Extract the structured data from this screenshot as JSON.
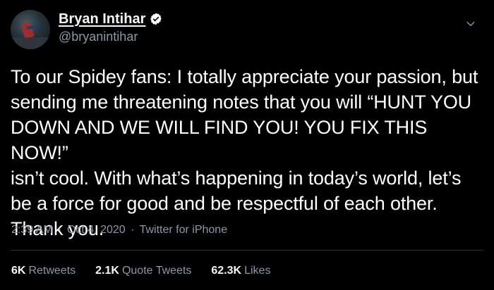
{
  "tweet": {
    "author": {
      "display_name": "Bryan Intihar",
      "handle": "@bryanintihar",
      "verified": true,
      "avatar_icon": "avatar-image"
    },
    "menu_icon": "chevron-down-icon",
    "text": "To our Spidey fans: I totally appreciate your passion, but\nsending me threatening notes that you will “HUNT YOU\nDOWN AND WE WILL FIND YOU! YOU FIX THIS NOW!”\nisn’t cool. With what’s happening in today’s world, let’s\nbe a force for good and be respectful of each other.\nThank you.",
    "meta": {
      "time": "2:39 AM",
      "separator_1": "·",
      "date": "Oct 4, 2020",
      "separator_2": "·",
      "source": "Twitter for iPhone"
    },
    "stats": [
      {
        "value": "6K",
        "label": "Retweets"
      },
      {
        "value": "2.1K",
        "label": "Quote Tweets"
      },
      {
        "value": "62.3K",
        "label": "Likes"
      }
    ]
  },
  "colors": {
    "background": "#000000",
    "primary_text": "#ffffff",
    "secondary_text": "#8b98a5",
    "divider": "#2f3336",
    "verified_badge": "#ffffff"
  }
}
